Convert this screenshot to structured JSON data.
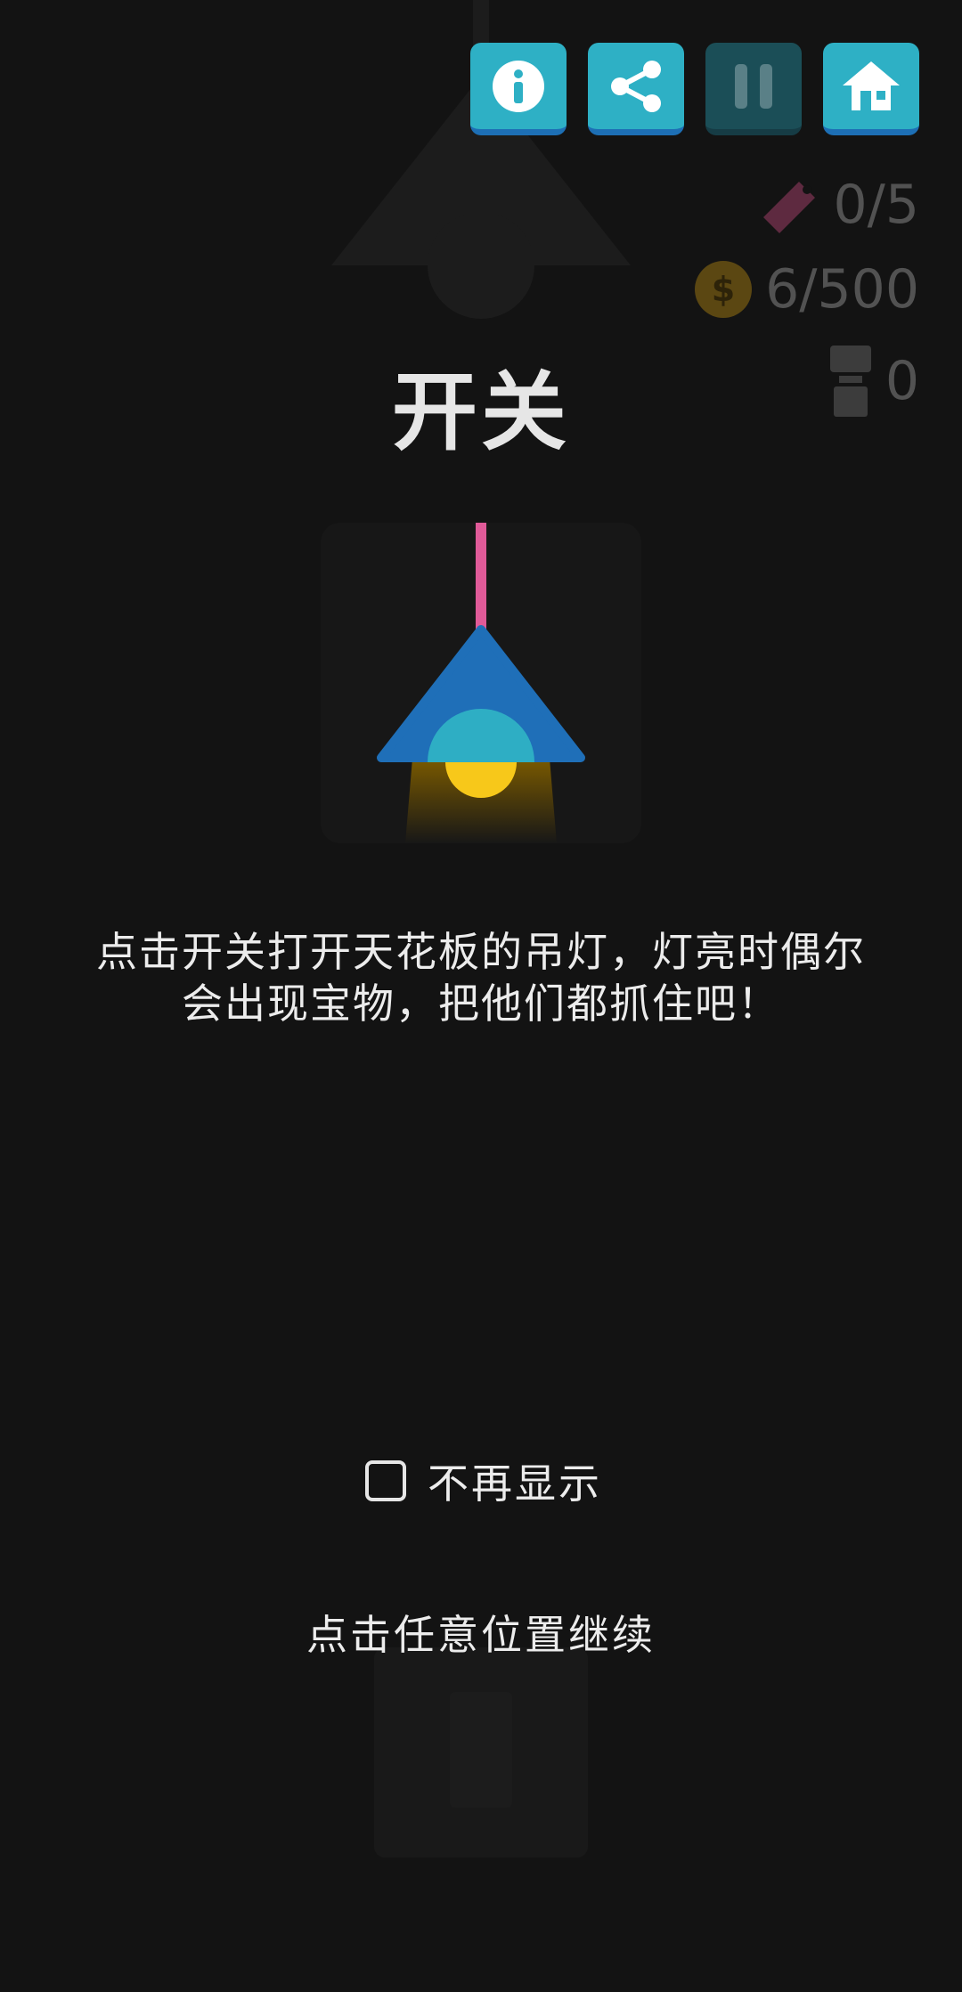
{
  "toolbar": {
    "info_icon": "info-icon",
    "share_icon": "share-icon",
    "pause_icon": "pause-icon",
    "home_icon": "home-icon"
  },
  "counters": {
    "tickets": "0/5",
    "coins": "6/500",
    "trophies": "0"
  },
  "tutorial": {
    "title": "开关",
    "description_line1": "点击开关打开天花板的吊灯，灯亮时偶尔",
    "description_line2": "会出现宝物，把他们都抓住吧！",
    "dont_show_label": "不再显示",
    "dont_show_checked": false,
    "continue_hint": "点击任意位置继续"
  },
  "colors": {
    "button_teal": "#2eb0c5",
    "button_shadow": "#1d6fb5",
    "lamp_shade": "#1f6fb8",
    "bulb_cover": "#2eaec4",
    "bulb": "#f7c81a",
    "cord": "#e05a98",
    "background": "#131313"
  }
}
